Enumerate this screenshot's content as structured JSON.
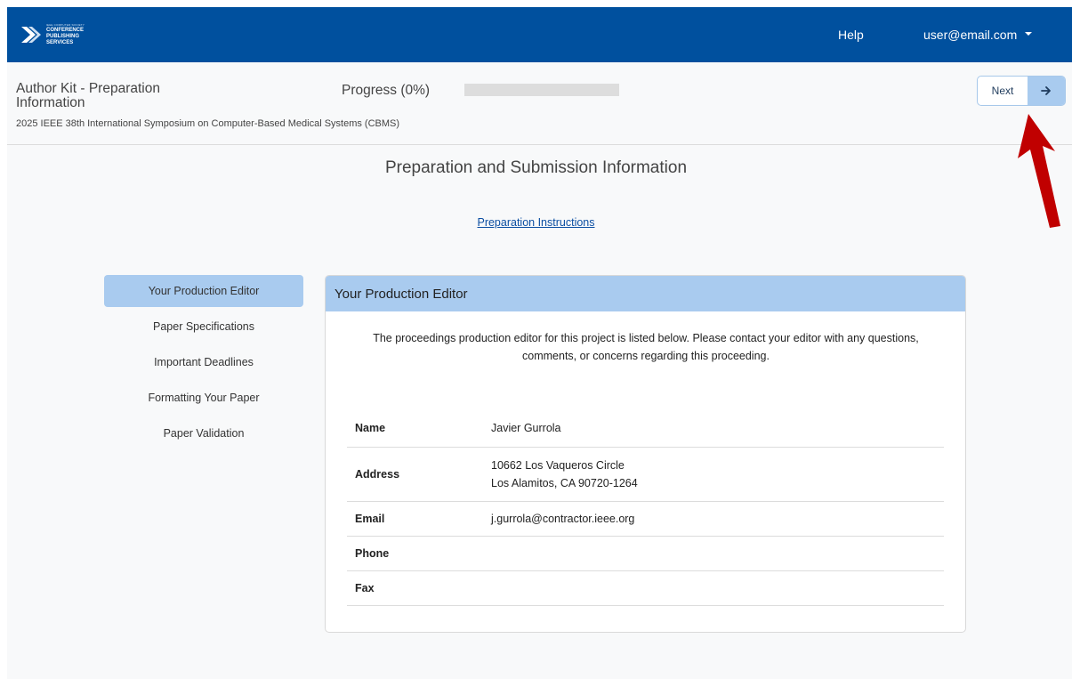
{
  "topnav": {
    "logo": {
      "small_text": "IEEE COMPUTER SOCIETY",
      "lines": [
        "CONFERENCE",
        "PUBLISHING",
        "SERVICES"
      ]
    },
    "help_label": "Help",
    "user_email": "user@email.com"
  },
  "header": {
    "title": "Author Kit - Preparation Information",
    "conference": "2025 IEEE 38th International Symposium on Computer-Based Medical Systems (CBMS)",
    "progress_label": "Progress (0%)",
    "progress_fraction": 0,
    "next_label": "Next",
    "next_icon": "arrow-right-icon"
  },
  "main": {
    "section_title": "Preparation and Submission Information",
    "instructions_link": "Preparation Instructions"
  },
  "sidebar": {
    "items": [
      {
        "label": "Your Production Editor",
        "active": true
      },
      {
        "label": "Paper Specifications",
        "active": false
      },
      {
        "label": "Important Deadlines",
        "active": false
      },
      {
        "label": "Formatting Your Paper",
        "active": false
      },
      {
        "label": "Paper Validation",
        "active": false
      }
    ]
  },
  "editor_card": {
    "title": "Your Production Editor",
    "intro": "The proceedings production editor for this project is listed below. Please contact your editor with any questions, comments, or concerns regarding this proceeding.",
    "rows": [
      {
        "label": "Name",
        "value": "Javier Gurrola"
      },
      {
        "label": "Address",
        "value_lines": [
          "10662 Los Vaqueros Circle",
          "Los Alamitos, CA 90720-1264"
        ]
      },
      {
        "label": "Email",
        "value": "j.gurrola@contractor.ieee.org"
      },
      {
        "label": "Phone",
        "value": ""
      },
      {
        "label": "Fax",
        "value": ""
      }
    ]
  },
  "colors": {
    "nav_blue": "#00509e",
    "accent_light_blue": "#a9cbef",
    "annotation_red": "#c00000"
  }
}
